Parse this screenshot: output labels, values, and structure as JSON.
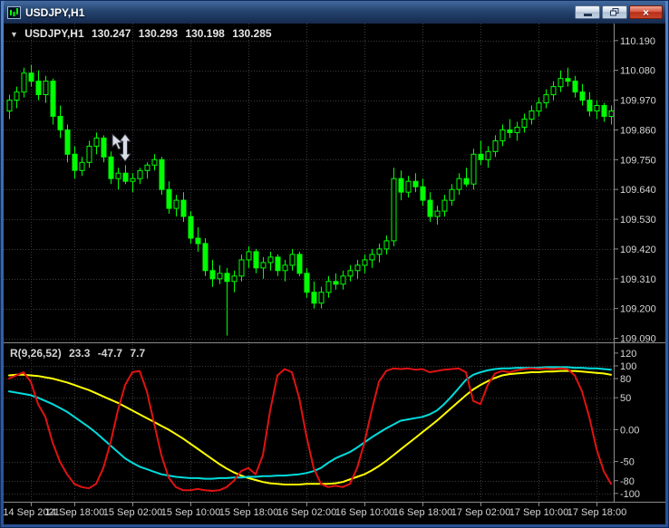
{
  "window": {
    "title": "USDJPY,H1",
    "controls": {
      "close_glyph": "×"
    }
  },
  "chart_header": {
    "expand_icon": "▼",
    "symbol_period": "USDJPY,H1",
    "open": "130.247",
    "high": "130.293",
    "low": "130.198",
    "close": "130.285"
  },
  "indicator_header": {
    "name": "R(9,26,52)",
    "values": [
      "23.3",
      "-47.7",
      "7.7"
    ]
  },
  "colors": {
    "background": "#000000",
    "candle": "#00FF00",
    "grid": "#3C3C3C",
    "axis_text": "#D6D6D6",
    "separator": "#8C8C8C",
    "rci_short": "#E01212",
    "rci_mid": "#FFFF00",
    "rci_long": "#00DCDC"
  },
  "chart_data": {
    "type": "candlestick",
    "symbol": "USDJPY",
    "timeframe": "H1",
    "main": {
      "price_min": 109.075,
      "price_max": 110.253,
      "axis_labels": [
        "110.190",
        "110.080",
        "109.970",
        "109.860",
        "109.750",
        "109.640",
        "109.530",
        "109.420",
        "109.310",
        "109.200",
        "109.090"
      ],
      "candles": [
        [
          109.93,
          109.99,
          109.9,
          109.97
        ],
        [
          109.97,
          110.02,
          109.94,
          110.0
        ],
        [
          110.0,
          110.09,
          109.98,
          110.07
        ],
        [
          110.07,
          110.1,
          110.02,
          110.04
        ],
        [
          110.04,
          110.08,
          109.97,
          109.99
        ],
        [
          109.99,
          110.06,
          109.96,
          110.04
        ],
        [
          110.04,
          110.05,
          109.88,
          109.91
        ],
        [
          109.91,
          109.95,
          109.83,
          109.86
        ],
        [
          109.86,
          109.88,
          109.74,
          109.77
        ],
        [
          109.77,
          109.8,
          109.68,
          109.71
        ],
        [
          109.71,
          109.76,
          109.69,
          109.74
        ],
        [
          109.74,
          109.82,
          109.72,
          109.8
        ],
        [
          109.8,
          109.85,
          109.77,
          109.83
        ],
        [
          109.83,
          109.84,
          109.74,
          109.76
        ],
        [
          109.76,
          109.78,
          109.66,
          109.68
        ],
        [
          109.68,
          109.72,
          109.64,
          109.7
        ],
        [
          109.7,
          109.73,
          109.66,
          109.67
        ],
        [
          109.67,
          109.7,
          109.63,
          109.68
        ],
        [
          109.68,
          109.72,
          109.66,
          109.71
        ],
        [
          109.71,
          109.74,
          109.68,
          109.73
        ],
        [
          109.73,
          109.77,
          109.71,
          109.75
        ],
        [
          109.75,
          109.76,
          109.62,
          109.64
        ],
        [
          109.64,
          109.67,
          109.55,
          109.57
        ],
        [
          109.57,
          109.62,
          109.54,
          109.6
        ],
        [
          109.6,
          109.63,
          109.52,
          109.54
        ],
        [
          109.54,
          109.56,
          109.44,
          109.46
        ],
        [
          109.46,
          109.5,
          109.41,
          109.44
        ],
        [
          109.44,
          109.46,
          109.32,
          109.34
        ],
        [
          109.34,
          109.38,
          109.28,
          109.31
        ],
        [
          109.31,
          109.36,
          109.29,
          109.33
        ],
        [
          109.33,
          109.35,
          109.1,
          109.3
        ],
        [
          109.3,
          109.34,
          109.26,
          109.32
        ],
        [
          109.32,
          109.4,
          109.3,
          109.38
        ],
        [
          109.38,
          109.43,
          109.35,
          109.41
        ],
        [
          109.41,
          109.42,
          109.33,
          109.35
        ],
        [
          109.35,
          109.39,
          109.31,
          109.37
        ],
        [
          109.37,
          109.41,
          109.34,
          109.39
        ],
        [
          109.39,
          109.4,
          109.32,
          109.34
        ],
        [
          109.34,
          109.38,
          109.3,
          109.36
        ],
        [
          109.36,
          109.42,
          109.34,
          109.4
        ],
        [
          109.4,
          109.41,
          109.32,
          109.33
        ],
        [
          109.33,
          109.35,
          109.24,
          109.26
        ],
        [
          109.26,
          109.3,
          109.2,
          109.22
        ],
        [
          109.22,
          109.28,
          109.2,
          109.26
        ],
        [
          109.26,
          109.32,
          109.24,
          109.3
        ],
        [
          109.3,
          109.33,
          109.27,
          109.29
        ],
        [
          109.29,
          109.34,
          109.27,
          109.32
        ],
        [
          109.32,
          109.36,
          109.3,
          109.34
        ],
        [
          109.34,
          109.38,
          109.31,
          109.36
        ],
        [
          109.36,
          109.4,
          109.33,
          109.38
        ],
        [
          109.38,
          109.42,
          109.35,
          109.4
        ],
        [
          109.4,
          109.44,
          109.37,
          109.42
        ],
        [
          109.42,
          109.47,
          109.4,
          109.45
        ],
        [
          109.45,
          109.72,
          109.43,
          109.68
        ],
        [
          109.68,
          109.71,
          109.6,
          109.63
        ],
        [
          109.63,
          109.69,
          109.61,
          109.67
        ],
        [
          109.67,
          109.7,
          109.63,
          109.65
        ],
        [
          109.65,
          109.68,
          109.58,
          109.6
        ],
        [
          109.6,
          109.63,
          109.52,
          109.54
        ],
        [
          109.54,
          109.58,
          109.51,
          109.56
        ],
        [
          109.56,
          109.62,
          109.54,
          109.6
        ],
        [
          109.6,
          109.66,
          109.58,
          109.64
        ],
        [
          109.64,
          109.7,
          109.62,
          109.68
        ],
        [
          109.68,
          109.72,
          109.65,
          109.66
        ],
        [
          109.66,
          109.79,
          109.64,
          109.77
        ],
        [
          109.77,
          109.82,
          109.73,
          109.75
        ],
        [
          109.75,
          109.8,
          109.72,
          109.78
        ],
        [
          109.78,
          109.84,
          109.76,
          109.82
        ],
        [
          109.82,
          109.88,
          109.8,
          109.86
        ],
        [
          109.86,
          109.9,
          109.83,
          109.85
        ],
        [
          109.85,
          109.89,
          109.82,
          109.87
        ],
        [
          109.87,
          109.92,
          109.85,
          109.9
        ],
        [
          109.9,
          109.95,
          109.88,
          109.93
        ],
        [
          109.93,
          109.98,
          109.91,
          109.96
        ],
        [
          109.96,
          110.01,
          109.94,
          109.99
        ],
        [
          109.99,
          110.04,
          109.97,
          110.02
        ],
        [
          110.02,
          110.08,
          110.0,
          110.05
        ],
        [
          110.05,
          110.09,
          110.02,
          110.04
        ],
        [
          110.04,
          110.06,
          109.98,
          110.0
        ],
        [
          110.0,
          110.03,
          109.95,
          109.97
        ],
        [
          109.97,
          110.0,
          109.91,
          109.93
        ],
        [
          109.93,
          109.97,
          109.9,
          109.95
        ],
        [
          109.95,
          109.96,
          109.89,
          109.91
        ],
        [
          109.91,
          109.95,
          109.88,
          109.93
        ]
      ]
    },
    "indicator": {
      "name": "R(9,26,52)",
      "value_min": -113,
      "value_max": 134,
      "axis_labels": [
        "120",
        "100",
        "80",
        "50",
        "0.00",
        "-50",
        "-80",
        "-100"
      ],
      "axis_values": [
        120,
        100,
        80,
        50,
        0,
        -50,
        -80,
        -100
      ],
      "levels": [
        100,
        80,
        50,
        0,
        -50,
        -80,
        -100
      ],
      "series": [
        {
          "name": "rci-26",
          "color": "#FFFF00",
          "values": [
            85,
            86,
            86,
            85,
            84,
            82,
            80,
            77,
            74,
            70,
            66,
            62,
            57,
            52,
            47,
            42,
            36,
            30,
            24,
            18,
            12,
            6,
            0,
            -7,
            -14,
            -22,
            -30,
            -38,
            -46,
            -54,
            -61,
            -67,
            -72,
            -76,
            -79,
            -82,
            -84,
            -85,
            -86,
            -86,
            -86,
            -85,
            -85,
            -85,
            -85,
            -84,
            -82,
            -78,
            -74,
            -70,
            -64,
            -57,
            -49,
            -40,
            -31,
            -22,
            -13,
            -4,
            5,
            14,
            24,
            34,
            44,
            54,
            63,
            70,
            76,
            81,
            85,
            87,
            88,
            89,
            90,
            90,
            91,
            91,
            92,
            92,
            92,
            91,
            90,
            89,
            88,
            86
          ]
        },
        {
          "name": "rci-52",
          "color": "#00DCDC",
          "values": [
            60,
            58,
            56,
            54,
            50,
            45,
            40,
            34,
            28,
            20,
            12,
            4,
            -5,
            -15,
            -25,
            -35,
            -45,
            -52,
            -58,
            -62,
            -66,
            -70,
            -72,
            -74,
            -75,
            -76,
            -76,
            -77,
            -77,
            -76,
            -76,
            -75,
            -75,
            -74,
            -74,
            -73,
            -73,
            -72,
            -72,
            -71,
            -70,
            -68,
            -65,
            -60,
            -52,
            -45,
            -40,
            -35,
            -28,
            -20,
            -12,
            -5,
            2,
            8,
            14,
            16,
            18,
            20,
            24,
            30,
            40,
            52,
            65,
            78,
            86,
            90,
            93,
            95,
            96,
            96,
            97,
            97,
            97,
            97,
            98,
            98,
            98,
            98,
            97,
            97,
            96,
            96,
            95,
            94
          ]
        },
        {
          "name": "rci-9",
          "color": "#E01212",
          "values": [
            80,
            85,
            90,
            75,
            40,
            20,
            -20,
            -50,
            -70,
            -85,
            -90,
            -92,
            -85,
            -60,
            -20,
            30,
            70,
            90,
            92,
            60,
            10,
            -40,
            -75,
            -90,
            -95,
            -95,
            -93,
            -95,
            -96,
            -95,
            -90,
            -80,
            -65,
            -60,
            -70,
            -40,
            30,
            85,
            95,
            90,
            50,
            -10,
            -60,
            -85,
            -90,
            -88,
            -90,
            -85,
            -60,
            -20,
            30,
            75,
            92,
            96,
            95,
            96,
            94,
            95,
            90,
            92,
            94,
            95,
            96,
            90,
            45,
            40,
            70,
            88,
            92,
            90,
            93,
            95,
            96,
            95,
            96,
            95,
            96,
            95,
            85,
            60,
            20,
            -30,
            -65,
            -85
          ]
        }
      ]
    },
    "time_labels": [
      {
        "text": "14 Sep 2021",
        "index": 3
      },
      {
        "text": "14 Sep 18:00",
        "index": 9
      },
      {
        "text": "15 Sep 02:00",
        "index": 17
      },
      {
        "text": "15 Sep 10:00",
        "index": 25
      },
      {
        "text": "15 Sep 18:00",
        "index": 33
      },
      {
        "text": "16 Sep 02:00",
        "index": 41
      },
      {
        "text": "16 Sep 10:00",
        "index": 49
      },
      {
        "text": "16 Sep 18:00",
        "index": 57
      },
      {
        "text": "17 Sep 02:00",
        "index": 65
      },
      {
        "text": "17 Sep 10:00",
        "index": 73
      },
      {
        "text": "17 Sep 18:00",
        "index": 81
      }
    ]
  }
}
